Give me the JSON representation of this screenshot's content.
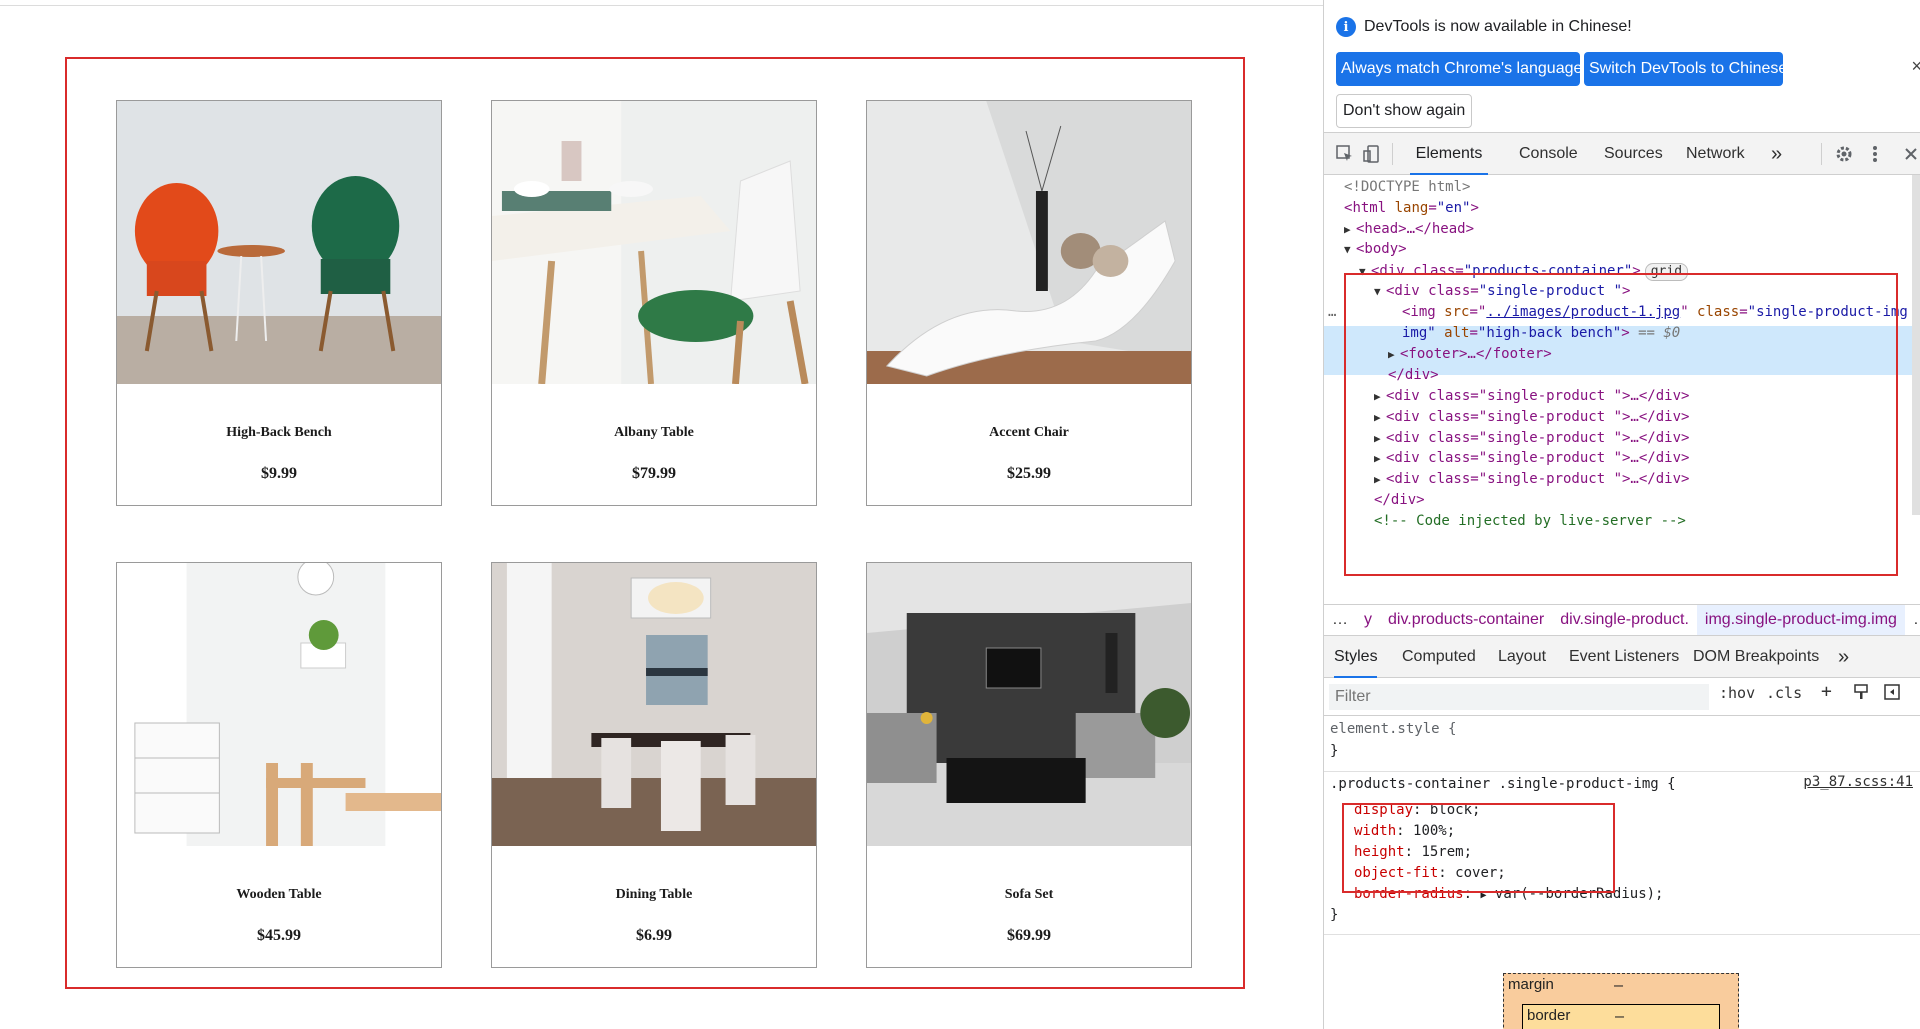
{
  "products": [
    {
      "name": "High-Back Bench",
      "price": "$9.99",
      "scene": "chairs"
    },
    {
      "name": "Albany Table",
      "price": "$79.99",
      "scene": "dining-small"
    },
    {
      "name": "Accent Chair",
      "price": "$25.99",
      "scene": "lounge"
    },
    {
      "name": "Wooden Table",
      "price": "$45.99",
      "scene": "white-room"
    },
    {
      "name": "Dining Table",
      "price": "$6.99",
      "scene": "dining-room"
    },
    {
      "name": "Sofa Set",
      "price": "$69.99",
      "scene": "living-room"
    }
  ],
  "devtools": {
    "info_text": "DevTools is now available in Chinese!",
    "btn_match": "Always match Chrome's language",
    "btn_switch": "Switch DevTools to Chinese",
    "btn_dont": "Don't show again",
    "close": "×",
    "tabs": [
      "Elements",
      "Console",
      "Sources",
      "Network"
    ],
    "more": "»",
    "dom": {
      "doctype": "<!DOCTYPE html>",
      "html_tag": "html",
      "html_attr": "lang",
      "html_val": "\"en\"",
      "head": "<head>…</head>",
      "body": "<body>",
      "container_tag": "<div class=",
      "container_val": "\"products-container\"",
      "grid": "grid",
      "single_open": "<div class=",
      "single_val": "\"single-product \"",
      "img_src_attr": "src",
      "img_src": "../images/product-1.jpg",
      "img_class_attr": "class",
      "img_class": "\"single-product-img",
      "img_class2": "img\"",
      "img_alt_attr": "alt",
      "img_alt": "\"high-back bench\"",
      "eq": "== $0",
      "footer": "<footer>…</footer>",
      "div_close": "</div>",
      "collapsed_row": "<div class=\"single-product \">…</div>",
      "comment": "<!-- Code injected by live-server -->",
      "ellipsis": "…"
    },
    "breadcrumb": [
      "…",
      "y",
      "div.products-container",
      "div.single-product.",
      "img.single-product-img.img",
      "…"
    ],
    "styles_tabs": [
      "Styles",
      "Computed",
      "Layout",
      "Event Listeners",
      "DOM Breakpoints"
    ],
    "filter_placeholder": "Filter",
    "filter_tools": [
      ":hov",
      ".cls",
      "+"
    ],
    "element_style": "element.style {",
    "close_brace": "}",
    "selector": ".products-container .single-product-img {",
    "source": "p3_87.scss:41",
    "props": [
      {
        "name": "display",
        "value": "block;"
      },
      {
        "name": "width",
        "value": "100%;"
      },
      {
        "name": "height",
        "value": "15rem;"
      },
      {
        "name": "object-fit",
        "value": "cover;"
      }
    ],
    "border_radius_name": "border-radius",
    "border_radius_value": "var(--borderRadius);",
    "boxmodel_margin": "margin",
    "boxmodel_border": "border",
    "boxmodel_dash": "–"
  },
  "colors": {
    "accent": "#1a73e8",
    "highlight": "#d92b2b"
  }
}
